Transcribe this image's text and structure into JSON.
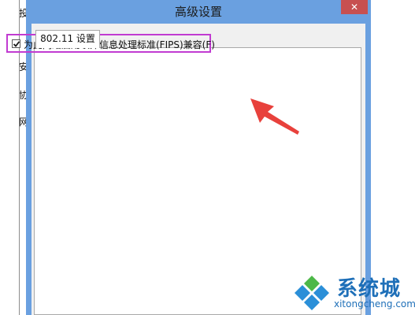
{
  "background_window": {
    "chars": [
      "投",
      "安",
      "协",
      "网"
    ]
  },
  "dialog": {
    "title": "高级设置",
    "close_glyph": "✕",
    "tabs": [
      {
        "label": "802.11 设置"
      }
    ],
    "fips_option": {
      "label": "为此网络启用联邦信息处理标准(FIPS)兼容(F)",
      "checked": true
    }
  },
  "annotation": {
    "highlight_color": "#c13bd1",
    "arrow_color": "#e8413c"
  },
  "watermark": {
    "name": "系统城",
    "url": "xitongcheng.com"
  },
  "colors": {
    "title_bar": "#6aa0e0",
    "close_button": "#c75050"
  }
}
